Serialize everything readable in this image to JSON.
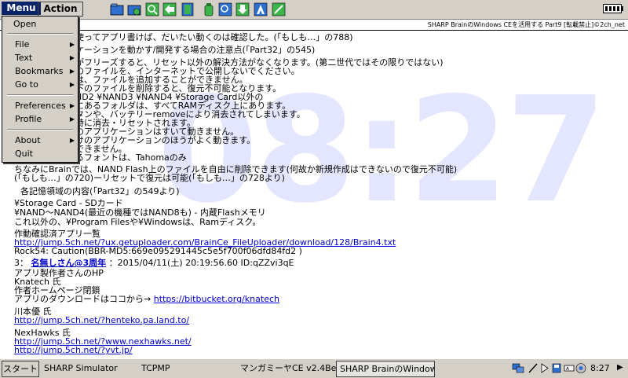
{
  "menubar": {
    "menu_label": "Menu",
    "action_label": "Action"
  },
  "header": {
    "text": "SHARP BrainのWindows CEを活用する Part9 [転載禁止]©2ch_net"
  },
  "watermark": "08:27",
  "menu": {
    "items": [
      {
        "label": "Open",
        "submenu": false
      },
      {
        "label": "File",
        "submenu": true
      },
      {
        "label": "Text",
        "submenu": true
      },
      {
        "label": "Bookmarks",
        "submenu": true
      },
      {
        "label": "Go to",
        "submenu": true
      },
      {
        "label": "Preferences",
        "submenu": true
      },
      {
        "label": "Profile",
        "submenu": true
      },
      {
        "label": "About",
        "submenu": true
      },
      {
        "label": "Quit",
        "submenu": false
      }
    ],
    "submenu_arrow": "▶"
  },
  "content": {
    "lines": [
      "使ってアプリ書けば、だいたい動くのは確認した。(「もしも…」の788)",
      "ケーションを動かす/開発する場合の注意点(「Part32」の545)",
      "がフリーズすると、リセット以外の解決方法がなくなります。(第二世代ではその限りではない)",
      "のファイルを、インターネットで公開しないでください。",
      "は、ファイルを追加することができません。",
      "下のファイルを削除すると、復元不可能となります。",
      "ND2 ¥NAND3 ¥NAND4 ¥Storage Card以外の",
      "にあるフォルダは、すべてRAMディスク上にあります。",
      "タンや、バッテリーremoveにより消去されてしまいます。",
      "時に消去・リセットされます。",
      "のアプリケーションはすいて動きません。",
      "けのアプリケーションのほうがよく動きます。",
      "できません。",
      "るフォントは、Tahomaのみ"
    ],
    "nand_note": "ちなみにBrainでは、NAND Flash上のファイルを自由に削除できます(何故か新規作成はできないので復元不可能)",
    "nand_note2": "(「もしも…」の720)ーリセットで復元は可能(「もしも…」の728より)",
    "storage_heading": "各記憶領域の内容(「Part32」の549より)",
    "storage_lines": [
      "¥Storage Card - SDカード",
      "¥NAND〜NAND4(最近の機種ではNAND8も) - 内蔵Flashメモリ",
      "これ以外の、¥Program Filesや¥Windowsは、Ramディスク。"
    ],
    "confirmed_apps": "作動確認済アプリ一覧",
    "uploader_url": "http://jump.5ch.net/?ux.getuploader.com/BrainCe_FileUploader/download/128/Brain4.txt",
    "rock54": "Rock54: Caution(BBR-MD5:669e095291445c5e5f700f06dfd84fd2 )",
    "post_number": "3：",
    "post_name": "名無しさん@3周年",
    "post_date": "：2015/04/11(土) 20:19:56.60 ID:qZZvi3qE",
    "app_author_heading": "アプリ製作者さんのHP",
    "knatech_name": "Knatech 氏",
    "author_homepage": "作者ホームページ閉鎖",
    "download_note": "アプリのダウンロードはココから→",
    "bitbucket_url": "https://bitbucket.org/knatech",
    "kawamoto_name": "川本優 氏",
    "kawamoto_url": "http://jump.5ch.net/?henteko.pa.land.to/",
    "nexhawks_name": "NexHawks 氏",
    "nexhawks_url1": "http://jump.5ch.net/?www.nexhawks.net/",
    "nexhawks_url2": "http://jump.5ch.net/?yvt.jp/"
  },
  "taskbar": {
    "start_label": "スタート",
    "tasks": [
      "SHARP Simulator",
      "TCPMP",
      "マンガミーヤCE v2.4Beta",
      "SHARP BrainのWindow"
    ],
    "clock": "8:27",
    "nav_arrow": "▶"
  },
  "colors": {
    "menu_highlight": "#0a246a",
    "link": "#0000cc",
    "watermark": "#e4e6ff",
    "chrome": "#d4d0c8"
  }
}
